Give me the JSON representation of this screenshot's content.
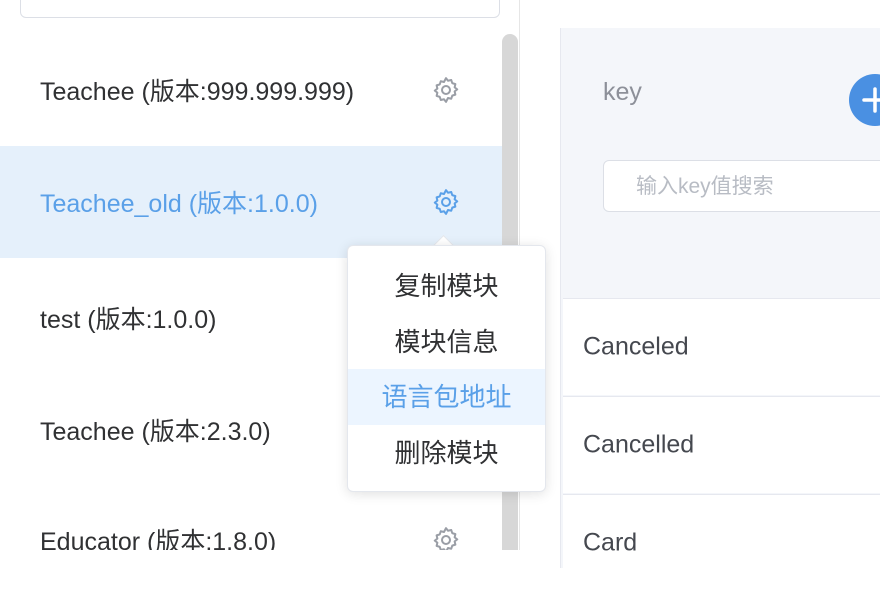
{
  "sidebar": {
    "modules": [
      {
        "label": "Teachee (版本:999.999.999)",
        "icon": "gear-icon"
      },
      {
        "label": "Teachee_old (版本:1.0.0)",
        "icon": "gear-icon",
        "selected": true
      },
      {
        "label": "test (版本:1.0.0)"
      },
      {
        "label": "Teachee (版本:2.3.0)"
      },
      {
        "label": "Educator (版本:1.8.0)",
        "icon": "gear-icon"
      }
    ]
  },
  "dropdown": {
    "items": [
      "复制模块",
      "模块信息",
      "语言包地址",
      "删除模块"
    ],
    "hover_index": 2
  },
  "right": {
    "key_label": "key",
    "search_placeholder": "输入key值搜索",
    "keys": [
      "Canceled",
      "Cancelled",
      "Card"
    ]
  },
  "colors": {
    "accent": "#4a90e2",
    "selected_bg": "#e5f0fb"
  }
}
